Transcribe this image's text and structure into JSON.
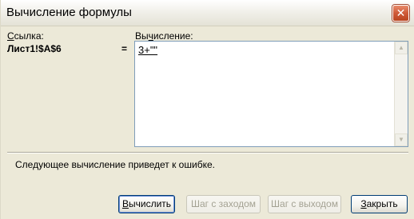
{
  "window": {
    "title": "Вычисление формулы",
    "close_symbol": "✕"
  },
  "reference": {
    "label_rest": "сылка:",
    "label_accel": "С",
    "value": "Лист1!$A$6"
  },
  "equals": "=",
  "evaluation": {
    "label_pre": "Вы",
    "label_accel": "ч",
    "label_post": "исление:",
    "value": "3+\"\""
  },
  "status": "Следующее вычисление приведет к ошибке.",
  "buttons": {
    "evaluate": {
      "pre": "",
      "accel": "В",
      "post": "ычислить",
      "enabled": true
    },
    "step_in": {
      "label": "Шаг с заходом",
      "enabled": false
    },
    "step_out": {
      "label": "Шаг с выходом",
      "enabled": false
    },
    "close": {
      "pre": "",
      "accel": "З",
      "post": "акрыть",
      "enabled": true
    }
  }
}
